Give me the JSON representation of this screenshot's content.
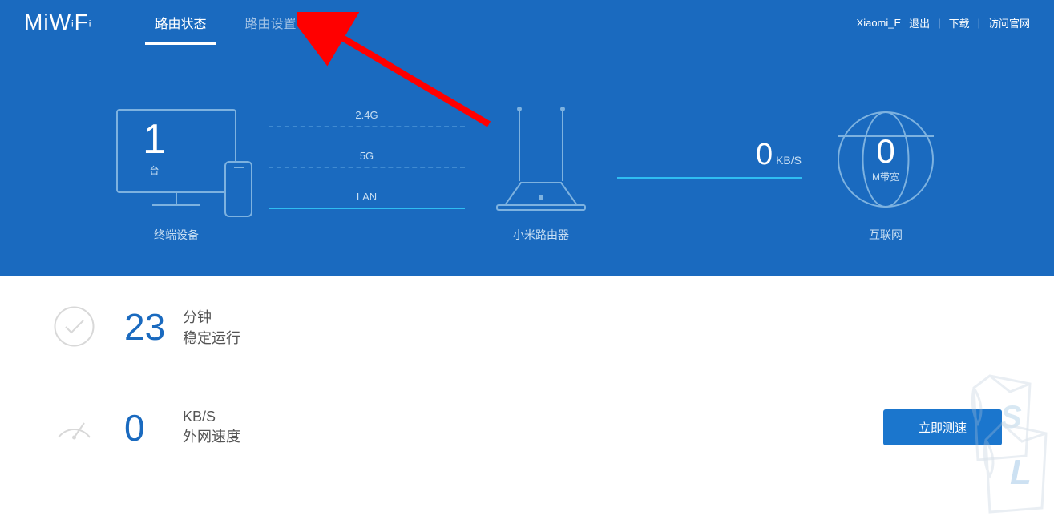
{
  "logo": "MiWiFi",
  "tabs": {
    "status": "路由状态",
    "settings": "路由设置"
  },
  "topRight": {
    "user": "Xiaomi_E",
    "logout": "退出",
    "download": "下载",
    "official": "访问官网"
  },
  "diagram": {
    "devices": {
      "count": "1",
      "unit": "台",
      "label": "终端设备"
    },
    "connections": {
      "band24": "2.4G",
      "band5": "5G",
      "lan": "LAN"
    },
    "router": {
      "label": "小米路由器"
    },
    "speed": {
      "value": "0",
      "unit": "KB/S"
    },
    "internet": {
      "value": "0",
      "unit": "M带宽",
      "label": "互联网"
    }
  },
  "stats": {
    "uptime": {
      "value": "23",
      "unit": "分钟",
      "label": "稳定运行"
    },
    "wan": {
      "value": "0",
      "unit": "KB/S",
      "label": "外网速度",
      "button": "立即测速"
    }
  }
}
